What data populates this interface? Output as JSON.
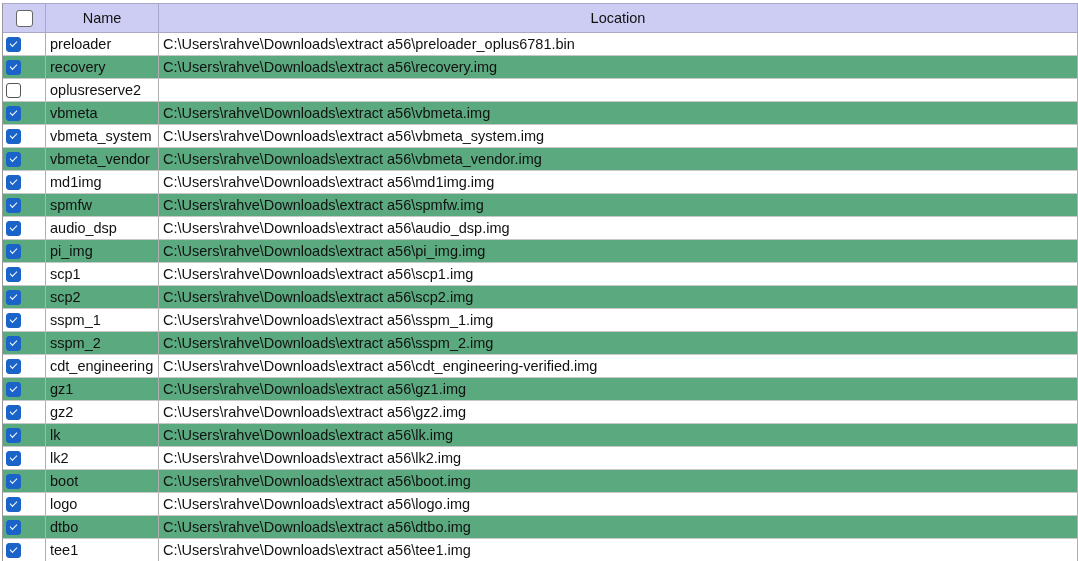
{
  "table": {
    "header": {
      "checked": false
    },
    "columns": [
      "Name",
      "Location"
    ],
    "rows": [
      {
        "checked": true,
        "name": "preloader",
        "location": "C:\\Users\\rahve\\Downloads\\extract a56\\preloader_oplus6781.bin"
      },
      {
        "checked": true,
        "name": "recovery",
        "location": "C:\\Users\\rahve\\Downloads\\extract a56\\recovery.img"
      },
      {
        "checked": false,
        "name": "oplusreserve2"
      },
      {
        "checked": true,
        "name": "vbmeta",
        "location": "C:\\Users\\rahve\\Downloads\\extract a56\\vbmeta.img"
      },
      {
        "checked": true,
        "name": "vbmeta_system",
        "location": "C:\\Users\\rahve\\Downloads\\extract a56\\vbmeta_system.img"
      },
      {
        "checked": true,
        "name": "vbmeta_vendor",
        "location": "C:\\Users\\rahve\\Downloads\\extract a56\\vbmeta_vendor.img"
      },
      {
        "checked": true,
        "name": "md1img",
        "location": "C:\\Users\\rahve\\Downloads\\extract a56\\md1img.img"
      },
      {
        "checked": true,
        "name": "spmfw",
        "location": "C:\\Users\\rahve\\Downloads\\extract a56\\spmfw.img"
      },
      {
        "checked": true,
        "name": "audio_dsp",
        "location": "C:\\Users\\rahve\\Downloads\\extract a56\\audio_dsp.img"
      },
      {
        "checked": true,
        "name": "pi_img",
        "location": "C:\\Users\\rahve\\Downloads\\extract a56\\pi_img.img"
      },
      {
        "checked": true,
        "name": "scp1",
        "location": "C:\\Users\\rahve\\Downloads\\extract a56\\scp1.img"
      },
      {
        "checked": true,
        "name": "scp2",
        "location": "C:\\Users\\rahve\\Downloads\\extract a56\\scp2.img"
      },
      {
        "checked": true,
        "name": "sspm_1",
        "location": "C:\\Users\\rahve\\Downloads\\extract a56\\sspm_1.img"
      },
      {
        "checked": true,
        "name": "sspm_2",
        "location": "C:\\Users\\rahve\\Downloads\\extract a56\\sspm_2.img"
      },
      {
        "checked": true,
        "name": "cdt_engineering",
        "location": "C:\\Users\\rahve\\Downloads\\extract a56\\cdt_engineering-verified.img"
      },
      {
        "checked": true,
        "name": "gz1",
        "location": "C:\\Users\\rahve\\Downloads\\extract a56\\gz1.img"
      },
      {
        "checked": true,
        "name": "gz2",
        "location": "C:\\Users\\rahve\\Downloads\\extract a56\\gz2.img"
      },
      {
        "checked": true,
        "name": "lk",
        "location": "C:\\Users\\rahve\\Downloads\\extract a56\\lk.img"
      },
      {
        "checked": true,
        "name": "lk2",
        "location": "C:\\Users\\rahve\\Downloads\\extract a56\\lk2.img"
      },
      {
        "checked": true,
        "name": "boot",
        "location": "C:\\Users\\rahve\\Downloads\\extract a56\\boot.img"
      },
      {
        "checked": true,
        "name": "logo",
        "location": "C:\\Users\\rahve\\Downloads\\extract a56\\logo.img"
      },
      {
        "checked": true,
        "name": "dtbo",
        "location": "C:\\Users\\rahve\\Downloads\\extract a56\\dtbo.img"
      },
      {
        "checked": true,
        "name": "tee1",
        "location": "C:\\Users\\rahve\\Downloads\\extract a56\\tee1.img"
      }
    ]
  }
}
